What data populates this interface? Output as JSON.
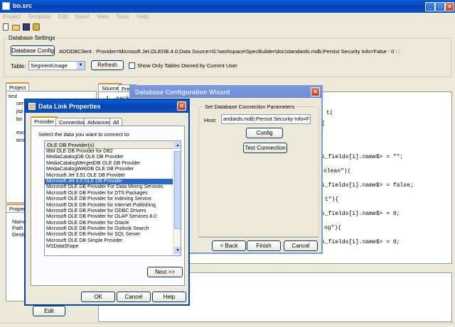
{
  "main_window": {
    "title": "bo.src",
    "menu": [
      "Project",
      "Template",
      "Edit",
      "Insert",
      "View",
      "Tools",
      "Help"
    ]
  },
  "db_settings": {
    "group_label": "Database Settings",
    "config_button": "Database Config",
    "connection_string": "ADODBClient : Provider=Microsoft.Jet.OLEDB.4.0;Data Source=G:\\workspace\\SpecBuilder\\doc\\standards.mdb;Persist Security Info=False : 0 :  :",
    "table_label": "Table:",
    "table_value": "SegmentUsage",
    "refresh_button": "Refresh",
    "checkbox_label": "Show Only Tables Owned by Current User"
  },
  "project_panel": {
    "tab_label": "Project",
    "tree": [
      "test",
      "serv",
      "jsp",
      "bo",
      "exce",
      "test"
    ]
  },
  "properties_panel": {
    "tab_label": "Properti",
    "rows": [
      "Name",
      "Path",
      "Destin"
    ],
    "edit_button": "Edit"
  },
  "editor": {
    "tabs": [
      "Source",
      "Previ"
    ],
    "line_number": "1",
    "first_line": "pack",
    "code_lines": [
      "t(",
      "{",
      "s_fields[i].name$> = \"\";",
      "olean\")(",
      "s_fields[i].name$> = false;",
      "t\"){",
      "s_fields[i].name$> = 0;",
      "ng\"){",
      "s_fields[i].name$> = 0;"
    ]
  },
  "wizard": {
    "title": "Database Configuration Wizard",
    "group_label": "Set Database Connection Parameters",
    "host_label": "Host:",
    "host_value": "andards.mdb;Persist Security Info=False",
    "config_button": "Config",
    "test_button": "Test Connection",
    "back_button": "< Back",
    "finish_button": "Finish",
    "cancel_button": "Cancel"
  },
  "datalink": {
    "title": "Data Link Properties",
    "tabs": [
      "Provider",
      "Connection",
      "Advanced",
      "All"
    ],
    "instruction": "Select the data you want to connect to:",
    "list_header": "OLE DB Provider(s)",
    "providers": [
      "IBM OLE DB Provider for DB2",
      "MediaCatalogDB OLE DB Provider",
      "MediaCatalogMergedDB OLE DB Provider",
      "MediaCatalogWebDB OLE DB Provider",
      "Microsoft Jet 3.51 OLE DB Provider",
      "Microsoft Jet 4.0 OLE DB Provider",
      "Microsoft OLE DB Provider For Data Mining Services",
      "Microsoft OLE DB Provider for DTS Packages",
      "Microsoft OLE DB Provider for Indexing Service",
      "Microsoft OLE DB Provider for Internet Publishing",
      "Microsoft OLE DB Provider for ODBC Drivers",
      "Microsoft OLE DB Provider for OLAP Services 8.0",
      "Microsoft OLE DB Provider for Oracle",
      "Microsoft OLE DB Provider for Outlook Search",
      "Microsoft OLE DB Provider for SQL Server",
      "Microsoft OLE DB Simple Provider",
      "MSDataShape"
    ],
    "selected_index": 5,
    "next_button": "Next >>",
    "ok_button": "OK",
    "cancel_button": "Cancel",
    "help_button": "Help"
  },
  "colors": {
    "title_blue": "#0843b0",
    "selection": "#316ac5",
    "tab_accent": "#e68b2c"
  }
}
